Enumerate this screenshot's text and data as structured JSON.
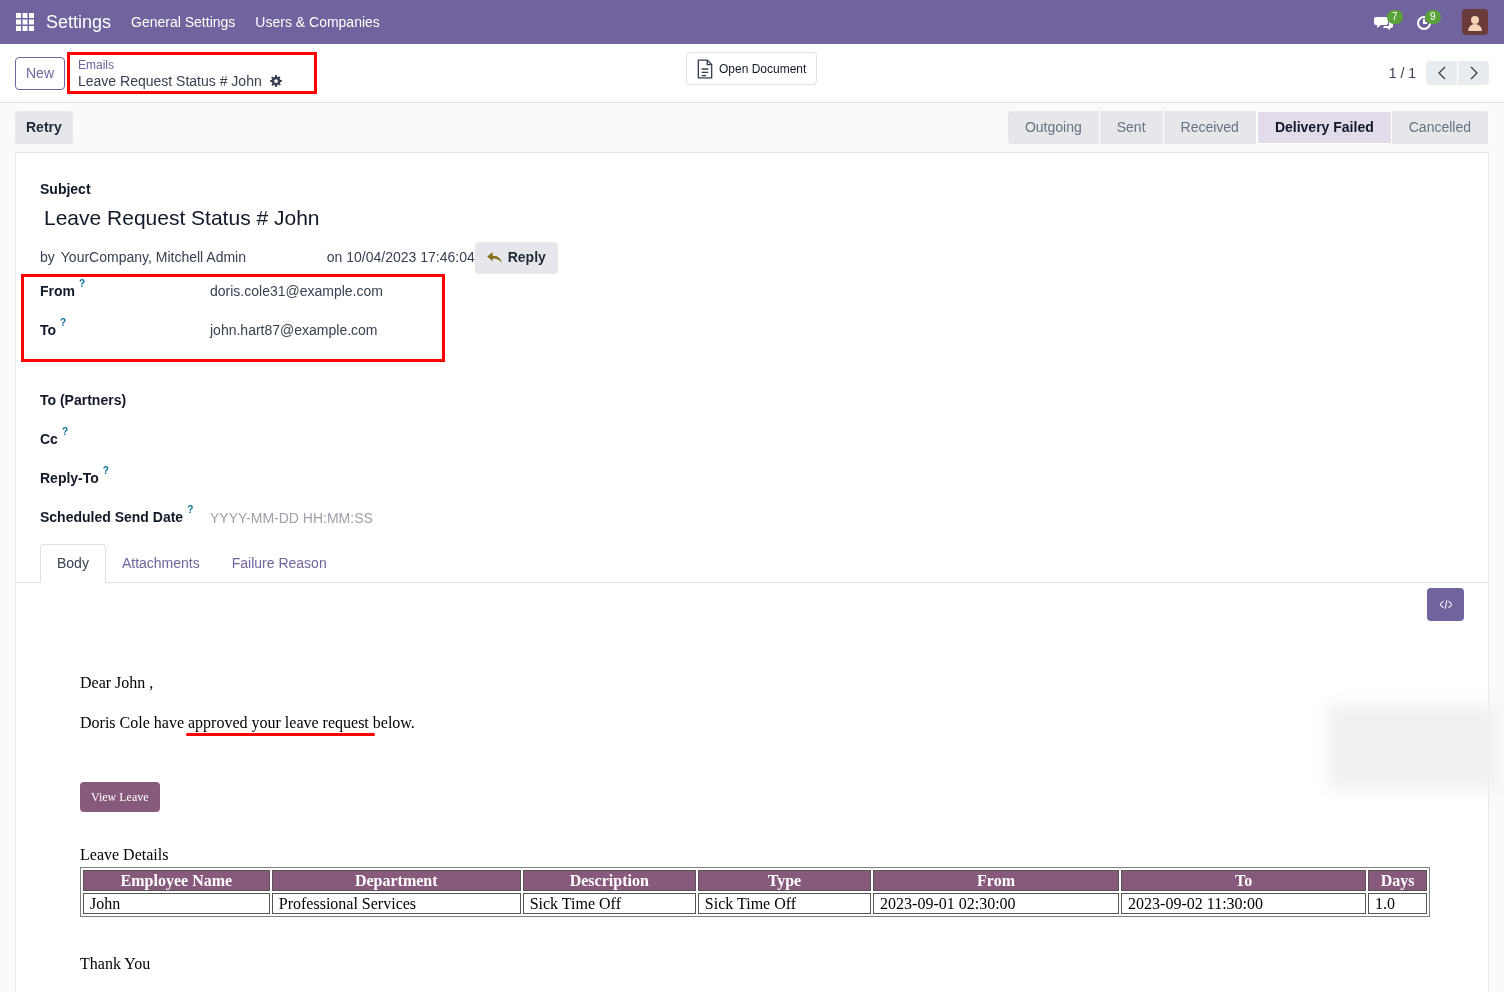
{
  "navbar": {
    "app": "Settings",
    "menu": [
      "General Settings",
      "Users & Companies"
    ],
    "messages_count": "7",
    "activities_count": "9"
  },
  "control_panel": {
    "new_button": "New",
    "breadcrumb": {
      "parent": "Emails",
      "current": "Leave Request Status # John",
      "highlighted": true
    },
    "open_document": "Open Document",
    "pager": "1 / 1"
  },
  "status_bar": {
    "button": "Retry",
    "stages": [
      {
        "label": "Outgoing",
        "selected": false
      },
      {
        "label": "Sent",
        "selected": false
      },
      {
        "label": "Received",
        "selected": false
      },
      {
        "label": "Delivery Failed",
        "selected": true
      },
      {
        "label": "Cancelled",
        "selected": false
      }
    ]
  },
  "form": {
    "subject_label": "Subject",
    "subject": "Leave Request Status # John",
    "by": "by",
    "author": "YourCompany, Mitchell Admin",
    "date": "on 10/04/2023 17:46:04",
    "reply": "Reply",
    "fields": [
      {
        "label": "From",
        "help": "?",
        "value": "doris.cole31@example.com",
        "highlighted": true
      },
      {
        "label": "To",
        "help": "?",
        "value": "john.hart87@example.com",
        "highlighted": true
      },
      {
        "label": "To (Partners)",
        "highlighted": false
      },
      {
        "label": "Cc",
        "help": "?",
        "highlighted": false
      },
      {
        "label": "Reply-To",
        "help": "?",
        "highlighted": false
      },
      {
        "label": "Scheduled Send Date",
        "help": "?",
        "placeholder": "YYYY-MM-DD HH:MM:SS",
        "highlighted": false
      }
    ],
    "tabs": [
      {
        "label": "Body",
        "selected": true
      },
      {
        "label": "Attachments",
        "selected": false
      },
      {
        "label": "Failure Reason",
        "selected": false
      }
    ]
  },
  "body": {
    "greeting": "Dear John ,",
    "message": {
      "before": "Doris Cole have ",
      "underlined": "approved your leave request",
      "after": " below."
    },
    "button": "View Leave",
    "table_title": "Leave Details",
    "table": {
      "columns": [
        "Employee Name",
        "Department",
        "Description",
        "Type",
        "From",
        "To",
        "Days"
      ],
      "rows": [
        [
          "John",
          "Professional Services",
          "Sick Time Off",
          "Sick Time Off",
          "2023-09-01 02:30:00",
          "2023-09-02 11:30:00",
          "1.0"
        ]
      ]
    },
    "closing": "Thank You"
  }
}
